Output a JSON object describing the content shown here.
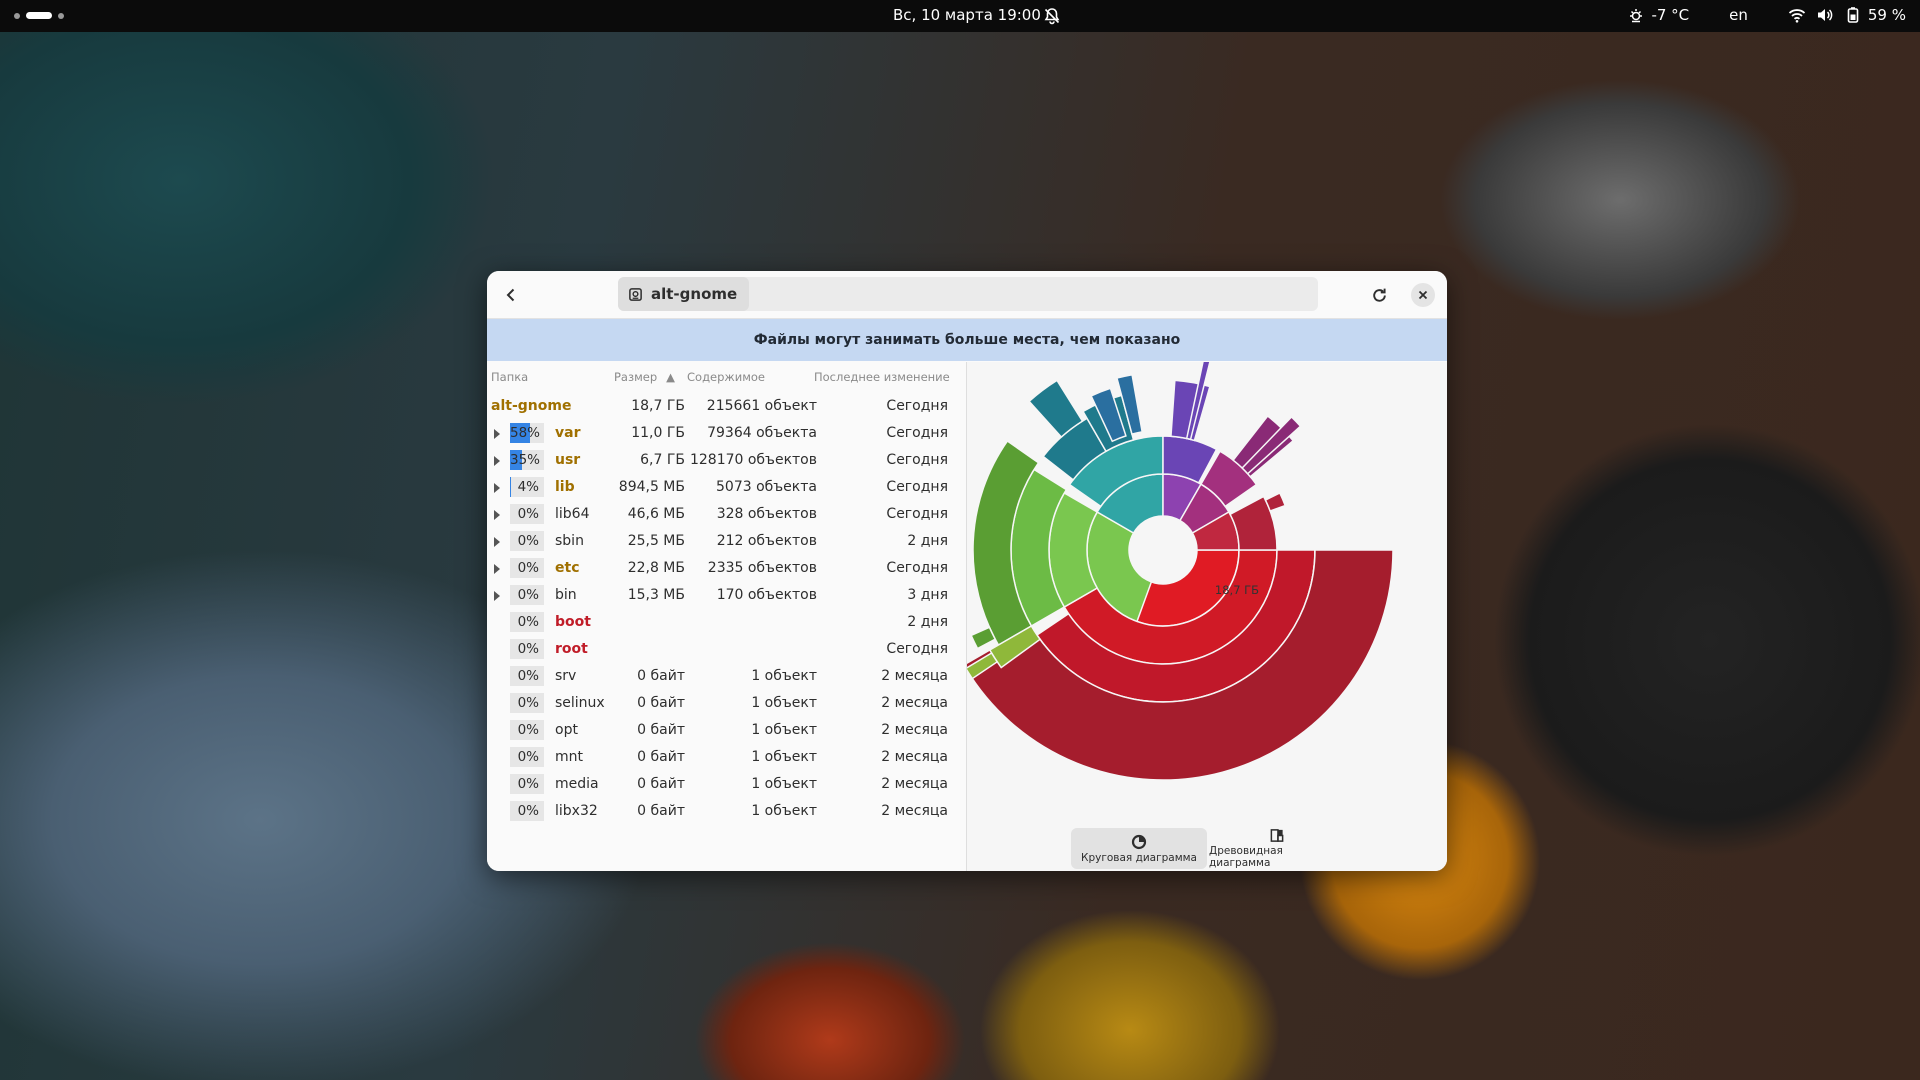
{
  "topbar": {
    "datetime": "Вс, 10 марта  19:00",
    "temperature": "-7 °C",
    "language": "en",
    "battery": "59 %"
  },
  "window": {
    "location": "alt-gnome",
    "banner": "Файлы могут занимать больше места, чем показано"
  },
  "columns": {
    "folder": "Папка",
    "size": "Размер",
    "contents": "Содержимое",
    "modified": "Последнее изменение"
  },
  "root": {
    "name": "alt-gnome",
    "size": "18,7 ГБ",
    "contents": "215661 объект",
    "modified": "Сегодня"
  },
  "rows": [
    {
      "pct": "58%",
      "pct_value": 58,
      "name": "var",
      "size": "11,0 ГБ",
      "contents": "79364 объекта",
      "modified": "Сегодня",
      "expandable": true,
      "color": "gold"
    },
    {
      "pct": "35%",
      "pct_value": 35,
      "name": "usr",
      "size": "6,7 ГБ",
      "contents": "128170 объектов",
      "modified": "Сегодня",
      "expandable": true,
      "color": "gold"
    },
    {
      "pct": "4%",
      "pct_value": 4,
      "name": "lib",
      "size": "894,5 МБ",
      "contents": "5073 объекта",
      "modified": "Сегодня",
      "expandable": true,
      "color": "gold"
    },
    {
      "pct": "0%",
      "pct_value": 0,
      "name": "lib64",
      "size": "46,6 МБ",
      "contents": "328 объектов",
      "modified": "Сегодня",
      "expandable": true,
      "color": "plain"
    },
    {
      "pct": "0%",
      "pct_value": 0,
      "name": "sbin",
      "size": "25,5 МБ",
      "contents": "212 объектов",
      "modified": "2 дня",
      "expandable": true,
      "color": "plain"
    },
    {
      "pct": "0%",
      "pct_value": 0,
      "name": "etc",
      "size": "22,8 МБ",
      "contents": "2335 объектов",
      "modified": "Сегодня",
      "expandable": true,
      "color": "gold"
    },
    {
      "pct": "0%",
      "pct_value": 0,
      "name": "bin",
      "size": "15,3 МБ",
      "contents": "170 объектов",
      "modified": "3 дня",
      "expandable": true,
      "color": "plain"
    },
    {
      "pct": "0%",
      "pct_value": 0,
      "name": "boot",
      "size": "",
      "contents": "",
      "modified": "2 дня",
      "expandable": false,
      "color": "red"
    },
    {
      "pct": "0%",
      "pct_value": 0,
      "name": "root",
      "size": "",
      "contents": "",
      "modified": "Сегодня",
      "expandable": false,
      "color": "red"
    },
    {
      "pct": "0%",
      "pct_value": 0,
      "name": "srv",
      "size": "0 байт",
      "contents": "1 объект",
      "modified": "2 месяца",
      "expandable": false,
      "color": "plain"
    },
    {
      "pct": "0%",
      "pct_value": 0,
      "name": "selinux",
      "size": "0 байт",
      "contents": "1 объект",
      "modified": "2 месяца",
      "expandable": false,
      "color": "plain"
    },
    {
      "pct": "0%",
      "pct_value": 0,
      "name": "opt",
      "size": "0 байт",
      "contents": "1 объект",
      "modified": "2 месяца",
      "expandable": false,
      "color": "plain"
    },
    {
      "pct": "0%",
      "pct_value": 0,
      "name": "mnt",
      "size": "0 байт",
      "contents": "1 объект",
      "modified": "2 месяца",
      "expandable": false,
      "color": "plain"
    },
    {
      "pct": "0%",
      "pct_value": 0,
      "name": "media",
      "size": "0 байт",
      "contents": "1 объект",
      "modified": "2 месяца",
      "expandable": false,
      "color": "plain"
    },
    {
      "pct": "0%",
      "pct_value": 0,
      "name": "libx32",
      "size": "0 байт",
      "contents": "1 объект",
      "modified": "2 месяца",
      "expandable": false,
      "color": "plain"
    }
  ],
  "chart": {
    "center_label": "18,7 ГБ",
    "colors": {
      "red": "#e01b24",
      "red_dark": "#a51d2d",
      "green": "#7ac74f",
      "green_dark": "#5a9e33",
      "teal": "#30a5a5",
      "teal_dark": "#1f7a8c",
      "purple": "#6a45b5",
      "magenta": "#a3307e"
    }
  },
  "view_tabs": {
    "ring": "Круговая диаграмма",
    "tree": "Древовидная диаграмма"
  },
  "theme": {
    "accent": "#3584e4",
    "banner_bg": "#c5d8f2",
    "gold_text": "#a07000",
    "red_text": "#c01c28"
  }
}
